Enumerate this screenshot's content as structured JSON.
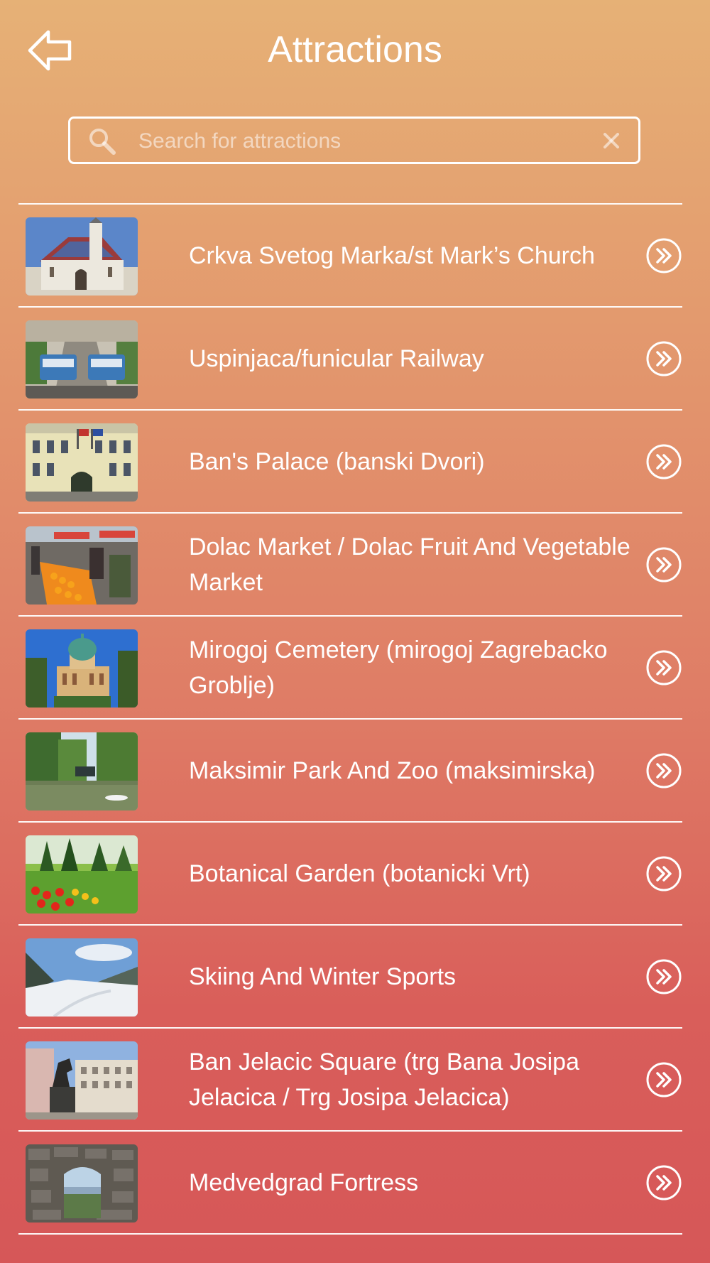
{
  "header": {
    "title": "Attractions",
    "back_icon": "back-arrow-icon"
  },
  "search": {
    "placeholder": "Search for attractions",
    "value": "",
    "search_icon": "search-icon",
    "clear_icon": "clear-icon"
  },
  "attractions": [
    {
      "name": "Crkva Svetog Marka/st Mark’s Church",
      "thumbnail": "church-photo"
    },
    {
      "name": "Uspinjaca/funicular Railway",
      "thumbnail": "funicular-photo"
    },
    {
      "name": "Ban's Palace (banski Dvori)",
      "thumbnail": "palace-photo"
    },
    {
      "name": "Dolac Market / Dolac Fruit And Vegetable Market",
      "thumbnail": "market-photo"
    },
    {
      "name": "Mirogoj Cemetery (mirogoj Zagrebacko Groblje)",
      "thumbnail": "cemetery-photo"
    },
    {
      "name": "Maksimir Park And Zoo (maksimirska)",
      "thumbnail": "park-photo"
    },
    {
      "name": "Botanical Garden (botanicki Vrt)",
      "thumbnail": "garden-photo"
    },
    {
      "name": "Skiing And Winter Sports",
      "thumbnail": "ski-slope-photo"
    },
    {
      "name": "Ban Jelacic Square (trg Bana Josipa Jelacica / Trg Josipa Jelacica)",
      "thumbnail": "square-photo"
    },
    {
      "name": "Medvedgrad Fortress",
      "thumbnail": "fortress-photo"
    }
  ],
  "colors": {
    "gradient_top": "#e6b176",
    "gradient_bottom": "#d65758",
    "foreground": "#ffffff"
  }
}
